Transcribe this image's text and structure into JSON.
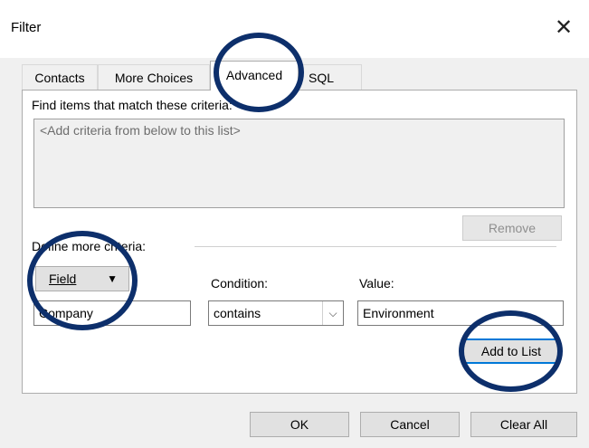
{
  "window": {
    "title": "Filter",
    "close_glyph": "✕"
  },
  "tabs": [
    {
      "label": "Contacts",
      "active": false
    },
    {
      "label": "More Choices",
      "active": false
    },
    {
      "label": "Advanced",
      "active": true
    },
    {
      "label": "SQL",
      "active": false
    }
  ],
  "advanced": {
    "find_label": "Find items that match these criteria:",
    "criteria_placeholder": "<Add criteria from below to this list>",
    "remove_label": "Remove",
    "define_label": "Define more criteria:",
    "field_button_label": "Field",
    "field_value": "Company",
    "condition_label": "Condition:",
    "condition_value": "contains",
    "value_label": "Value:",
    "value_value": "Environment",
    "add_to_list_label": "Add to List"
  },
  "footer": {
    "ok_label": "OK",
    "cancel_label": "Cancel",
    "clear_all_label": "Clear All"
  },
  "colors": {
    "annotation_circle": "#0d2f6b",
    "focus_border": "#0078d7"
  }
}
